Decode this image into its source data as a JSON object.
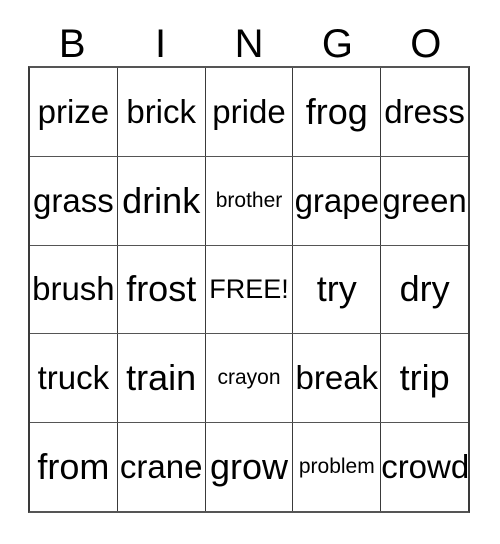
{
  "card": {
    "title": "BINGO",
    "header_letters": [
      "B",
      "I",
      "N",
      "G",
      "O"
    ],
    "free_space_label": "FREE!",
    "free_space_position": {
      "row": 2,
      "col": 2
    },
    "grid_size": "5x5",
    "colors": {
      "background": "#ffffff",
      "text": "#000000",
      "grid_line": "#3a3a3a"
    },
    "rows": [
      {
        "cells": [
          {
            "text": "prize",
            "size": "md"
          },
          {
            "text": "brick",
            "size": "md"
          },
          {
            "text": "pride",
            "size": "md"
          },
          {
            "text": "frog",
            "size": "lg"
          },
          {
            "text": "dress",
            "size": "md"
          }
        ]
      },
      {
        "cells": [
          {
            "text": "grass",
            "size": "md"
          },
          {
            "text": "drink",
            "size": "lg"
          },
          {
            "text": "brother",
            "size": "xs"
          },
          {
            "text": "grape",
            "size": "md"
          },
          {
            "text": "green",
            "size": "md"
          }
        ]
      },
      {
        "cells": [
          {
            "text": "brush",
            "size": "md"
          },
          {
            "text": "frost",
            "size": "lg"
          },
          {
            "text": "FREE!",
            "size": "free"
          },
          {
            "text": "try",
            "size": "lg"
          },
          {
            "text": "dry",
            "size": "lg"
          }
        ]
      },
      {
        "cells": [
          {
            "text": "truck",
            "size": "md"
          },
          {
            "text": "train",
            "size": "lg"
          },
          {
            "text": "crayon",
            "size": "xs"
          },
          {
            "text": "break",
            "size": "md"
          },
          {
            "text": "trip",
            "size": "lg"
          }
        ]
      },
      {
        "cells": [
          {
            "text": "from",
            "size": "lg"
          },
          {
            "text": "crane",
            "size": "md"
          },
          {
            "text": "grow",
            "size": "lg"
          },
          {
            "text": "problem",
            "size": "xs"
          },
          {
            "text": "crowd",
            "size": "md"
          }
        ]
      }
    ]
  }
}
